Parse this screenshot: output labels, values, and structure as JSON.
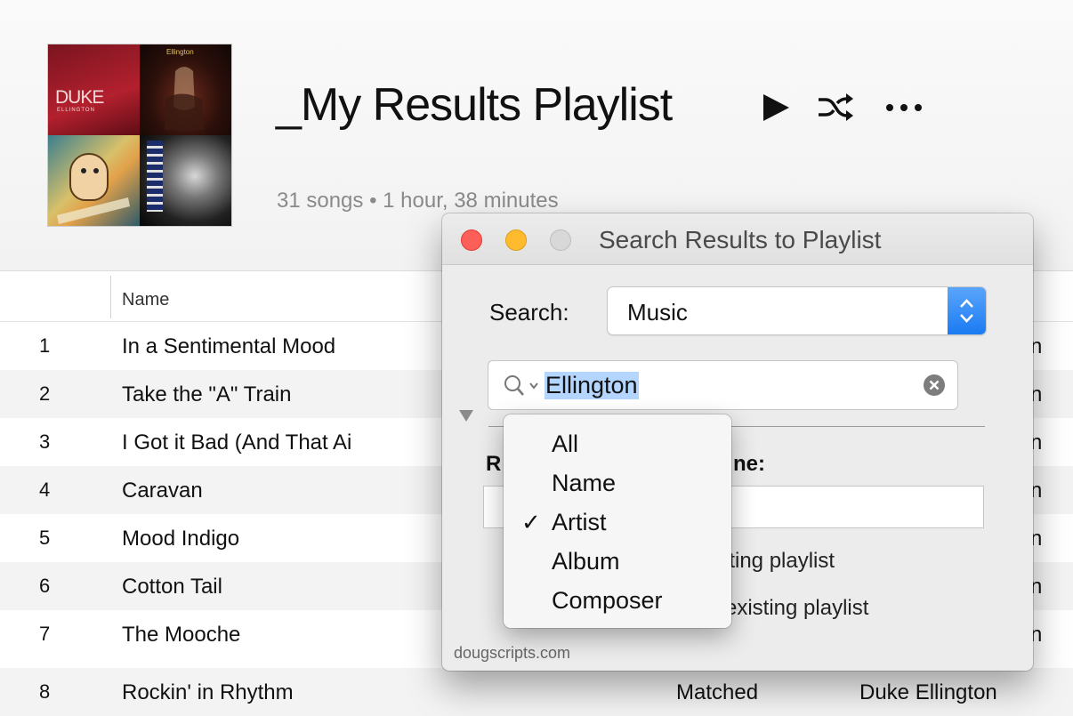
{
  "playlist": {
    "title": "_My Results Playlist",
    "subtitle": "31 songs • 1 hour, 38 minutes",
    "artwork_text": {
      "cover1_main": "DUKE",
      "cover1_sub": "ELLINGTON"
    },
    "controls": {
      "play_icon": "play-icon",
      "shuffle_icon": "shuffle-icon",
      "more_icon": "more-icon"
    }
  },
  "table": {
    "columns": {
      "name": "Name"
    },
    "rows": [
      {
        "num": "1",
        "name": "In a Sentimental Mood",
        "status": "",
        "artist_tail": "n"
      },
      {
        "num": "2",
        "name": "Take the \"A\" Train",
        "status": "",
        "artist_tail": "n"
      },
      {
        "num": "3",
        "name": "I Got it Bad (And That Ai",
        "status": "",
        "artist_tail": "n"
      },
      {
        "num": "4",
        "name": "Caravan",
        "status": "",
        "artist_tail": "n"
      },
      {
        "num": "5",
        "name": "Mood Indigo",
        "status": "",
        "artist_tail": "n"
      },
      {
        "num": "6",
        "name": "Cotton Tail",
        "status": "",
        "artist_tail": "n"
      },
      {
        "num": "7",
        "name": "The Mooche",
        "status": "",
        "artist_tail": "n"
      },
      {
        "num": "8",
        "name": "Rockin' in Rhythm",
        "status": "Matched",
        "artist_tail": "Duke Ellington"
      }
    ]
  },
  "dialog": {
    "title": "Search Results to Playlist",
    "search_label": "Search:",
    "search_source": "Music",
    "search_query": "Ellington",
    "partial_label_left": "R",
    "partial_label_right": "ne:",
    "partial_option_1": "isting playlist",
    "partial_option_2": "existing playlist",
    "credit": "dougscripts.com"
  },
  "search_scope_menu": {
    "items": [
      {
        "label": "All",
        "checked": ""
      },
      {
        "label": "Name",
        "checked": ""
      },
      {
        "label": "Artist",
        "checked": "✓"
      },
      {
        "label": "Album",
        "checked": ""
      },
      {
        "label": "Composer",
        "checked": ""
      }
    ]
  },
  "colors": {
    "accent_blue": "#1a7bf2",
    "selection_highlight": "#b4d5fe",
    "close_red": "#fc5f57",
    "minimize_yellow": "#fdbb2d",
    "zoom_gray": "#d8d8d8"
  }
}
